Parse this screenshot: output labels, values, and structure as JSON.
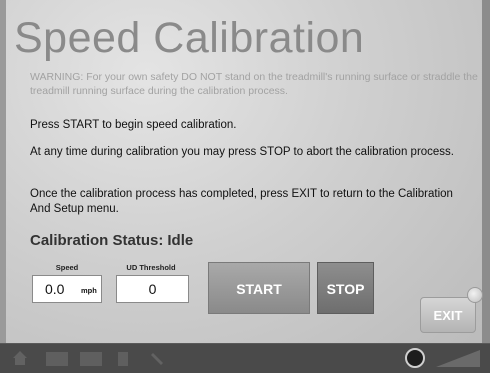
{
  "title": "Speed Calibration",
  "warning": "WARNING:  For your own safety DO NOT stand on the treadmill's running surface or straddle the treadmill running surface during the calibration process.",
  "instructions": [
    "Press START to begin speed calibration.",
    "At any time during calibration you may press STOP to abort the calibration process.",
    "Once the calibration process has completed, press EXIT to return to the Calibration And Setup menu."
  ],
  "status": {
    "label": "Calibration Status:",
    "value": "Idle"
  },
  "speed": {
    "label": "Speed",
    "value": "0.0",
    "unit": "mph"
  },
  "ud_threshold": {
    "label": "UD Threshold",
    "value": "0"
  },
  "buttons": {
    "start": "START",
    "stop": "STOP",
    "exit": "EXIT"
  },
  "taskbar_icons": [
    "home-icon",
    "window-icon",
    "window-icon",
    "device-icon",
    "wrench-icon",
    "volume-icon",
    "volume-level-icon"
  ],
  "colors": {
    "title": "#8a8a8a",
    "button": "#9a9a9a",
    "taskbar": "#4a4a4a"
  }
}
